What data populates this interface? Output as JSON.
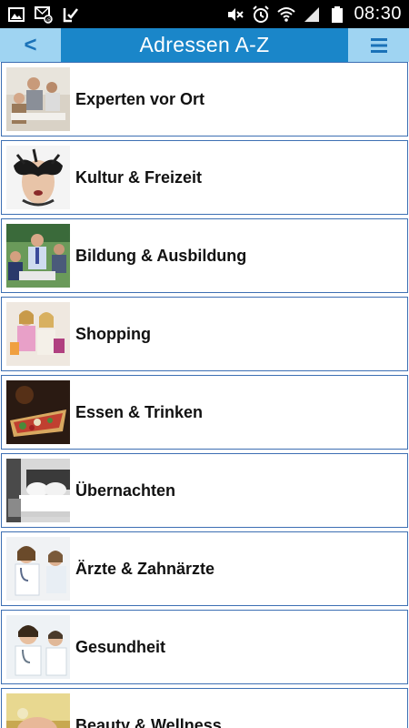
{
  "status_bar": {
    "time": "08:30",
    "left_icons": [
      "image-icon",
      "email-icon",
      "check-icon"
    ],
    "right_icons": [
      "mute-icon",
      "alarm-icon",
      "wifi-icon",
      "signal-icon",
      "battery-icon"
    ]
  },
  "header": {
    "back_label": "<",
    "title": "Adressen A-Z",
    "menu_icon": "hamburger-menu-icon",
    "colors": {
      "bar": "#1a86c9",
      "buttons": "#9fd4f2"
    }
  },
  "list": {
    "items": [
      {
        "label": "Experten vor Ort",
        "icon": "business-meeting-photo"
      },
      {
        "label": "Kultur & Freizeit",
        "icon": "carnival-mask-photo"
      },
      {
        "label": "Bildung & Ausbildung",
        "icon": "classroom-photo"
      },
      {
        "label": "Shopping",
        "icon": "shopping-women-photo"
      },
      {
        "label": "Essen & Trinken",
        "icon": "pizza-photo"
      },
      {
        "label": "Übernachten",
        "icon": "hotel-bed-photo"
      },
      {
        "label": "Ärzte & Zahnärzte",
        "icon": "doctors-photo"
      },
      {
        "label": "Gesundheit",
        "icon": "medical-staff-photo"
      },
      {
        "label": "Beauty & Wellness",
        "icon": "spa-photo"
      }
    ]
  }
}
